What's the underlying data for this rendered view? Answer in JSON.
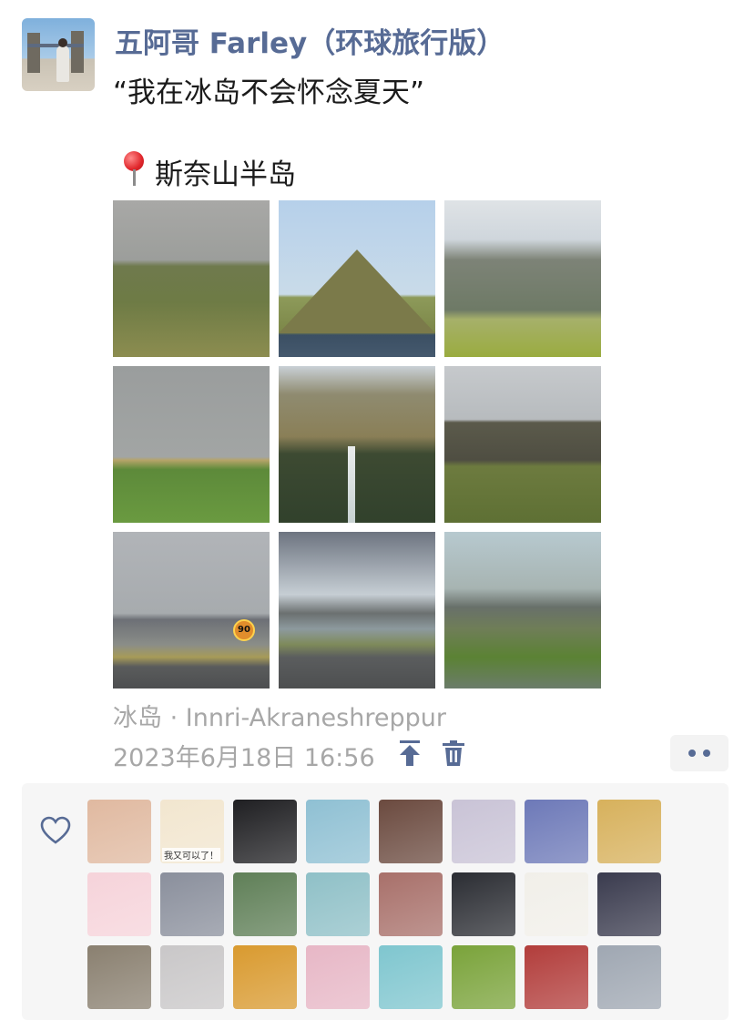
{
  "post": {
    "username": "五阿哥 Farley（环球旅行版）",
    "text": "“我在冰岛不会怀念夏天”",
    "location_line": "斯奈山半岛",
    "location_meta": "冰岛 · Innri-Akraneshreppur",
    "timestamp": "2023年6月18日 16:56"
  },
  "icons": {
    "pin": "round-pushpin-icon",
    "pin_top": "pin-to-top-icon",
    "delete": "trash-icon",
    "more": "more-dots-icon",
    "like": "heart-outline-icon"
  },
  "photos": [
    {
      "subject": "mountain-valley"
    },
    {
      "subject": "kirkjufell-mountain"
    },
    {
      "subject": "farm-by-mountains"
    },
    {
      "subject": "grassland-with-sheep"
    },
    {
      "subject": "waterfall-canyon"
    },
    {
      "subject": "basalt-cliffs"
    },
    {
      "subject": "road-with-speed-sign"
    },
    {
      "subject": "fjord-road"
    },
    {
      "subject": "coastal-road"
    }
  ],
  "speed_sign": "90",
  "likers": [
    {
      "color": "#e0b9a0"
    },
    {
      "color": "#f2e6cf",
      "text": "我又可以了！"
    },
    {
      "color": "#1f1f22"
    },
    {
      "color": "#8fc0d3"
    },
    {
      "color": "#6b4a3f"
    },
    {
      "color": "#c9c3d6"
    },
    {
      "color": "#6d79b8"
    },
    {
      "color": "#d7b15c"
    },
    {
      "color": "#f6d3da"
    },
    {
      "color": "#8a8f9c"
    },
    {
      "color": "#5f7f57"
    },
    {
      "color": "#8fc0c7"
    },
    {
      "color": "#a8706a"
    },
    {
      "color": "#2b2d33"
    },
    {
      "color": "#f1efe9"
    },
    {
      "color": "#3a3b4e"
    },
    {
      "color": "#8a8070"
    },
    {
      "color": "#c9c7c8"
    },
    {
      "color": "#d99a2f"
    },
    {
      "color": "#e7b7c6"
    },
    {
      "color": "#7fc6cf"
    },
    {
      "color": "#7aa33a"
    },
    {
      "color": "#b23d3b"
    },
    {
      "color": "#9fa7b2"
    }
  ]
}
